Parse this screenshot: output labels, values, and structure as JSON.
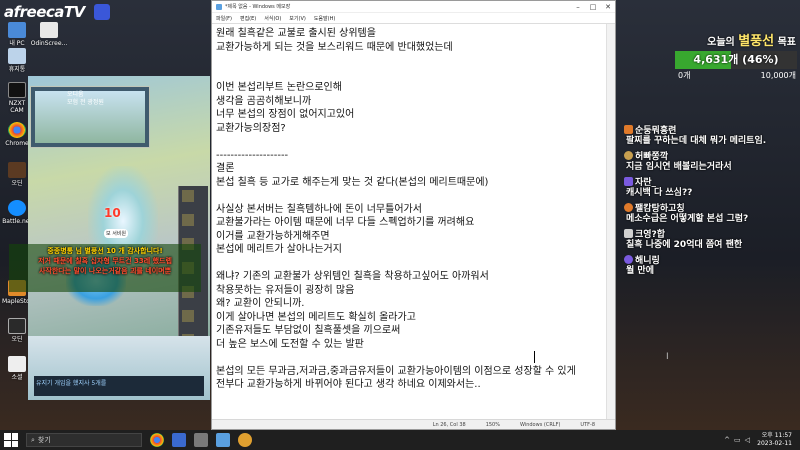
{
  "stream": {
    "logo": "afreecaTV",
    "desktop_icons": [
      "내 PC",
      "OdinScree...",
      "휴지통",
      "NZXT CAM",
      "Chrome",
      "오딘",
      "Battle.net",
      "MapleStory",
      "오딘",
      "소셜"
    ],
    "game_window_text": [
      "오디움",
      "모험 전 광정원"
    ],
    "level_badge_num": "10",
    "level_badge_label": "보 서비원",
    "bottom_tool_label": "유지기 개임을 했지사 5개를",
    "notice_lines": [
      "중종병통 님 별풍선 10 개 감사합니다!",
      "저거 때문에 칠흑 십자형 무트건 33레 했드렙",
      "사작한다는 말이 나오는거같음 괴를 네이며뿐"
    ]
  },
  "notepad": {
    "title": "*제목 없음 - Windows 메모장",
    "menu": [
      "파일(F)",
      "편집(E)",
      "서식(O)",
      "보기(V)",
      "도움말(H)"
    ],
    "lines": [
      "원래 칠흑같은 교불로 출시된 상위템을",
      "교환가능하게 되는 것을 보스리워드 때문에 반대했었는데",
      "",
      "",
      "이번 본섭리부트 논란으로인해",
      "생각을 곰곰히해보니까",
      "너무 본섭의 장점이 없어지고있어",
      "교환가능의장점?",
      "",
      "--------------------",
      "결론",
      "본섭 칠흑 등 교가로 해주는게 맞는 것 같다(본섭의 메리트때문에)",
      "",
      "사실상 본서버는 칠흑템하나에 돈이 너무틀어가서",
      "교환불가라는 아이템 때문에 너무 다들 스펙업하기를 꺼려해요",
      "이거를 교환가능하게해주면",
      "본섭에 메리트가 살아나는거지",
      "",
      "왜냐? 기존의 교환불가 상위템인 칠흑을 착용하고싶어도 아까워서",
      "착용못하는 유저들이 굉장히 많음",
      "왜? 교환이 안되니까.",
      "이게 살아나면 본섭의 메리트도 확실히 올라가고",
      "기존유저들도 부담없이 칠흑풀셋을 끼으로써",
      "더 높은 보스에 도전할 수 있는 발판",
      "",
      "본섭의 모든 무과금,저과금,중과금유저들이 교환가능아이템의 이점으로 성장할 수 있게",
      "전부다 교환가능하게 바뀌어야 된다고 생각 하네요 이제와서는.."
    ],
    "status": {
      "position": "Ln 26, Col 38",
      "zoom": "150%",
      "line_ending": "Windows (CRLF)",
      "encoding": "UTF-8"
    },
    "window_buttons": [
      "–",
      "□",
      "✕"
    ]
  },
  "goal": {
    "title_prefix": "오늘의",
    "title_highlight": "별풍선",
    "title_suffix": "목표",
    "value": "4,631개 (46%)",
    "progress_fraction": 0.46,
    "min": "0개",
    "max": "10,000개",
    "bar_color": "#38a82f"
  },
  "chat": [
    {
      "name": "순둥뭐흥련",
      "msg": "팔찌를 꾸하는데 대체 뭐가 메리트임.",
      "badge_color": "#e07a2a"
    },
    {
      "name": "허빠쫑깍",
      "msg": "지금 임시연 배볼리는거라서",
      "badge_color": "#c8a050"
    },
    {
      "name": "자란_",
      "msg": "캐시백 다 쓰심??",
      "badge_color": "#7a5adf"
    },
    {
      "name": "팰캄탕하고칭",
      "msg": "메소수급은 어떻게할 본섭 그럼?",
      "badge_color": "#e07a2a"
    },
    {
      "name": "크영?합",
      "msg": "칠흑 나중에 20억대 쯤여 팬한",
      "badge_color": "#d0d0d0"
    },
    {
      "name": "해니링",
      "msg": "월 만에",
      "badge_color": "#7a5adf"
    }
  ],
  "taskbar": {
    "search_placeholder": "찾기",
    "time": "오후 11:57",
    "date": "2023-02-11"
  }
}
